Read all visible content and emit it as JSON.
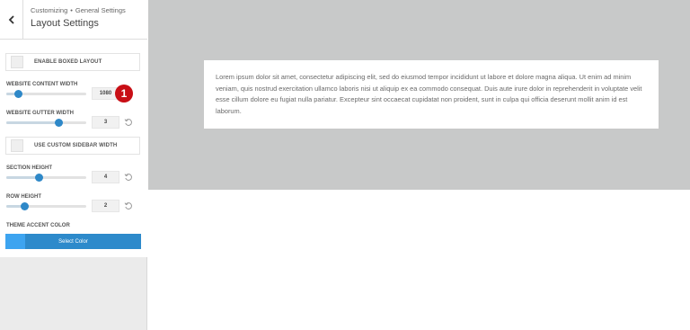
{
  "header": {
    "breadcrumb_root": "Customizing",
    "breadcrumb_separator": "•",
    "breadcrumb_current": "General Settings",
    "title": "Layout Settings",
    "back_icon": "chevron-left-icon"
  },
  "settings": {
    "boxed_layout": {
      "label": "ENABLE BOXED LAYOUT",
      "checked": false
    },
    "content_width": {
      "label": "WEBSITE CONTENT WIDTH",
      "value": "1080",
      "level": 0.15
    },
    "gutter_width": {
      "label": "WEBSITE GUTTER WIDTH",
      "value": "3",
      "level": 0.65
    },
    "custom_sidebar": {
      "label": "USE CUSTOM SIDEBAR WIDTH",
      "checked": false
    },
    "section_height": {
      "label": "SECTION HEIGHT",
      "value": "4",
      "level": 0.4
    },
    "row_height": {
      "label": "ROW HEIGHT",
      "value": "2",
      "level": 0.22
    },
    "accent_color": {
      "label": "THEME ACCENT COLOR",
      "button_label": "Select Color",
      "swatch": "#3da4f0"
    }
  },
  "annotation": {
    "badge": "1",
    "color": "#c80e15"
  },
  "preview": {
    "text": "Lorem ipsum dolor sit amet, consectetur adipiscing elit, sed do eiusmod tempor incididunt ut labore et dolore magna aliqua. Ut enim ad minim veniam, quis nostrud exercitation ullamco laboris nisi ut aliquip ex ea commodo consequat. Duis aute irure dolor in reprehenderit in voluptate velit esse cillum dolore eu fugiat nulla pariatur. Excepteur sint occaecat cupidatat non proident, sunt in culpa qui officia deserunt mollit anim id est laborum."
  },
  "colors": {
    "accent": "#2e88c8",
    "button": "#2d8acb",
    "preview_bg": "#c8c9c9"
  }
}
